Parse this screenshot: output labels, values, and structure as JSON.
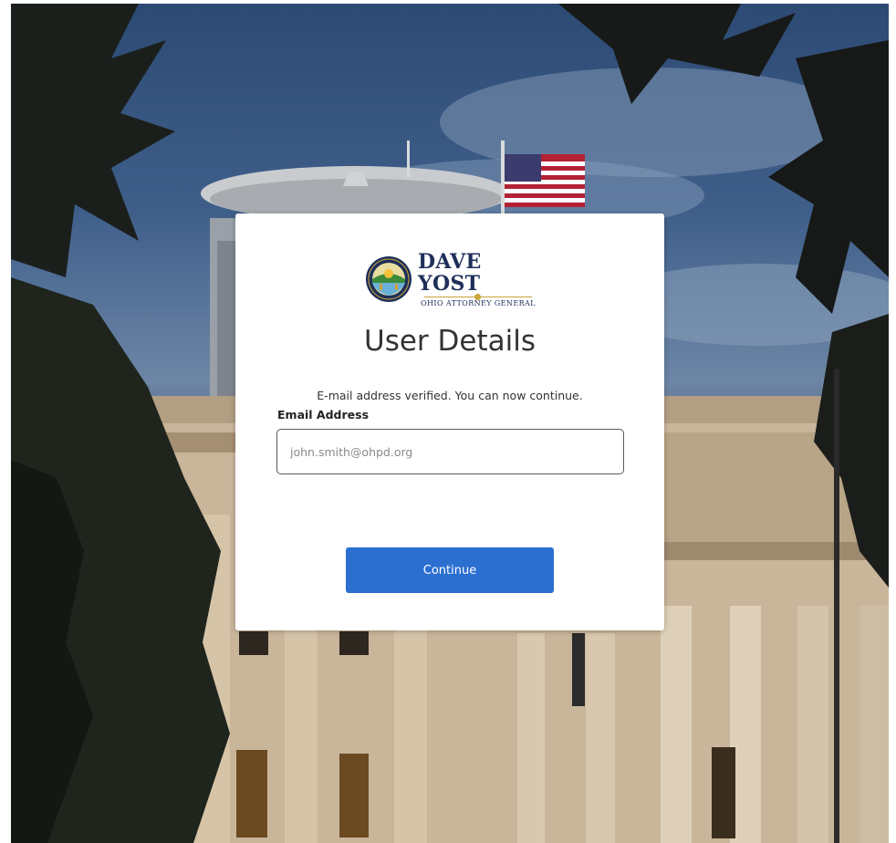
{
  "brand": {
    "name": "Dave Yost",
    "subtitle": "Ohio Attorney General",
    "colors": {
      "navy": "#1e2f58",
      "gold": "#c9a53a",
      "seal_green": "#3c8a3a"
    }
  },
  "page": {
    "title": "User Details",
    "intro": "E-mail address verified. You can now continue."
  },
  "form": {
    "email_label": "Email Address",
    "email_placeholder": "john.smith@ohpd.org",
    "email_value": "",
    "continue_label": "Continue"
  },
  "colors": {
    "primary_button": "#2b6fd1",
    "card_background": "#ffffff",
    "input_border": "#5a5a5a"
  },
  "icons": {
    "seal": "ohio-seal-icon"
  }
}
